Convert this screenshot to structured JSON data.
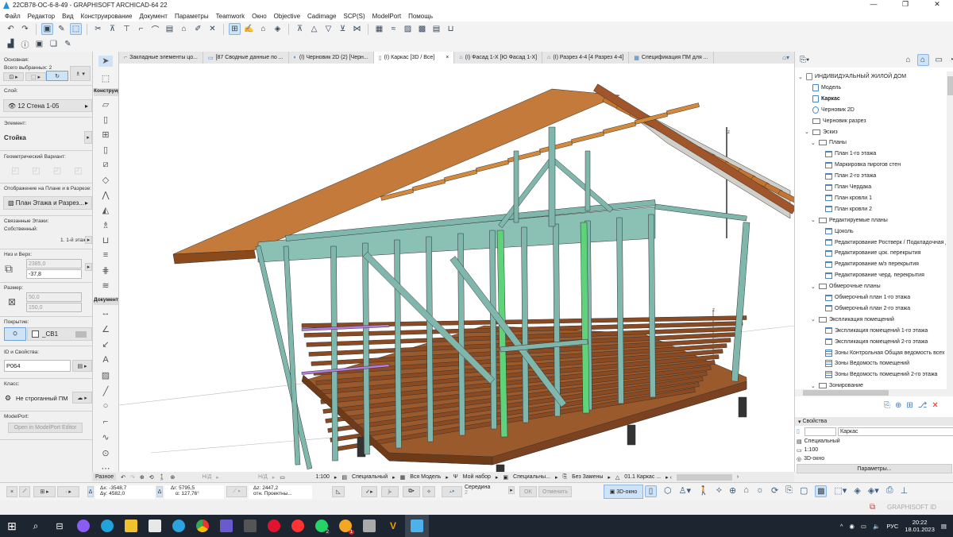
{
  "window": {
    "title": "22CB78-OC-6-8-49 - GRAPHISOFT ARCHICAD-64 22",
    "controls": [
      "—",
      "❐",
      "✕"
    ]
  },
  "menu": [
    "Файл",
    "Редактор",
    "Вид",
    "Конструирование",
    "Документ",
    "Параметры",
    "Teamwork",
    "Окно",
    "Objective",
    "Cadimage",
    "SCP(S)",
    "ModelPort",
    "Помощь"
  ],
  "tabs": [
    {
      "label": "Закладные элементы цо...",
      "icon": "plan-icon"
    },
    {
      "label": "[87 Сводные данные по ...",
      "icon": "layout-icon"
    },
    {
      "label": "(I) Черновик 2D (2) [Черн...",
      "icon": "worksheet-icon"
    },
    {
      "label": "(I) Каркас [3D / Все]",
      "icon": "3d-icon",
      "active": true,
      "close": "×"
    },
    {
      "label": "(I) Фасад 1-X [Ю Фасад 1-X]",
      "icon": "elevation-icon"
    },
    {
      "label": "(I) Разрез 4-4 [4 Разрез 4-4]",
      "icon": "section-icon"
    },
    {
      "label": "Спецификация ПМ для ...",
      "icon": "schedule-icon"
    }
  ],
  "info_box": {
    "main_label": "Основная:",
    "selected": "Всего выбранных: 2",
    "layer_label": "Слой:",
    "layer": "12 Стена 1-05",
    "element_label": "Элемент:",
    "element": "Стойка",
    "geom_label": "Геометрический Вариант:",
    "display_label": "Отображение на Плане и в Разрезе:",
    "display": "План Этажа и Разрез...",
    "linked_label": "Связанные Этажи:",
    "own_label": "Собственный:",
    "story": "1. 1-й этаж",
    "topbottom_label": "Низ и Верх:",
    "top": "2385,0",
    "bottom": "-37,8",
    "size_label": "Размер:",
    "size_w": "50,0",
    "size_h": "150,0",
    "surface_label": "Покрытие:",
    "surface": "_CB1",
    "id_label": "ID и Свойства:",
    "id": "P064",
    "class_label": "Класс:",
    "class": "Не строганный ПМ",
    "modelport_label": "ModelPort:",
    "modelport_btn": "Open in ModelPort Editor"
  },
  "toolbox": {
    "design": "Конструирование",
    "document": "Документирование",
    "misc": "Разное"
  },
  "navigator": {
    "items": [
      {
        "label": "ИНДИВИДУАЛЬНЫЙ ЖИЛОЙ ДОМ",
        "level": 0,
        "type": "project",
        "open": true
      },
      {
        "label": "Модель",
        "level": 1,
        "type": "view"
      },
      {
        "label": "Каркас",
        "level": 1,
        "type": "view",
        "bold": true
      },
      {
        "label": "Черновик 2D",
        "level": 1,
        "type": "worksheet"
      },
      {
        "label": "Черновик разрез",
        "level": 1,
        "type": "folder"
      },
      {
        "label": "Эскиз",
        "level": 1,
        "type": "folder",
        "open": true
      },
      {
        "label": "Планы",
        "level": 2,
        "type": "folder",
        "open": true
      },
      {
        "label": "План 1-го этажа",
        "level": 3,
        "type": "plan"
      },
      {
        "label": "Маркировка пирогов стен",
        "level": 3,
        "type": "plan"
      },
      {
        "label": "План 2-го этажа",
        "level": 3,
        "type": "plan"
      },
      {
        "label": "План Чердака",
        "level": 3,
        "type": "plan"
      },
      {
        "label": "План кровли 1",
        "level": 3,
        "type": "plan"
      },
      {
        "label": "План кровли 2",
        "level": 3,
        "type": "plan"
      },
      {
        "label": "Редактируемые планы",
        "level": 2,
        "type": "folder",
        "open": true
      },
      {
        "label": "Цоколь",
        "level": 3,
        "type": "plan"
      },
      {
        "label": "Редактирование Ростверк / Подкладочная д",
        "level": 3,
        "type": "plan"
      },
      {
        "label": "Редактирование цок. перекрытия",
        "level": 3,
        "type": "plan"
      },
      {
        "label": "Редактирование м/э перекрытия",
        "level": 3,
        "type": "plan"
      },
      {
        "label": "Редактирование черд. перекрытия",
        "level": 3,
        "type": "plan"
      },
      {
        "label": "Обмерочные планы",
        "level": 2,
        "type": "folder",
        "open": true
      },
      {
        "label": "Обмерочный план 1-го этажа",
        "level": 3,
        "type": "plan"
      },
      {
        "label": "Обмерочный план 2-го этажа",
        "level": 3,
        "type": "plan"
      },
      {
        "label": "Экспликация помещений",
        "level": 2,
        "type": "folder",
        "open": true
      },
      {
        "label": "Экспликация помещений 1-го этажа",
        "level": 3,
        "type": "plan"
      },
      {
        "label": "Экспликация помещений 2-го этажа",
        "level": 3,
        "type": "plan"
      },
      {
        "label": "Зоны Контрольная Общая ведомость всех п",
        "level": 3,
        "type": "table"
      },
      {
        "label": "Зоны Ведомость помещений",
        "level": 3,
        "type": "table"
      },
      {
        "label": "Зоны Ведомость помещений 2-го этажа",
        "level": 3,
        "type": "table"
      },
      {
        "label": "Зонирование",
        "level": 2,
        "type": "folder",
        "open": true
      }
    ],
    "props_title": "Свойства",
    "props_name": "Каркас",
    "props_set": "Специальный",
    "props_scale": "1:100",
    "props_type": "3D-окно",
    "params_btn": "Параметры..."
  },
  "viewbar": {
    "misc": "Разное",
    "na1": "Н/Д",
    "na2": "Н/Д",
    "scale": "1:100",
    "layers": "Специальный",
    "model": "Вся Модель",
    "pen": "Мой набор",
    "override": "Специальны...",
    "renov": "Без Замены",
    "dim": "01.1 Каркас ..."
  },
  "infobar": {
    "dx": "Δx: -3548,7",
    "dy": "Δy: 4582,0",
    "dr": "Δr: 5795,5",
    "da": "α: 127,76°",
    "dz": "Δz: 2447,2",
    "ref": "отн. Проектны...",
    "snap": "Середина",
    "snap_n": "2",
    "ok": "OK",
    "cancel": "Отменить",
    "view3d": "3D-окно"
  },
  "statusbar": {
    "brand": "GRAPHISOFT ID"
  },
  "taskbar": {
    "lang": "РУС",
    "time": "20:22",
    "date": "18.01.2023",
    "badges": [
      "2",
      "1"
    ]
  },
  "colors": {
    "frame": "#7fb7ad",
    "roof": "#c7742e",
    "floor": "#8b4a22",
    "selected": "#5fd37a",
    "accent": "#2a8fd8"
  }
}
